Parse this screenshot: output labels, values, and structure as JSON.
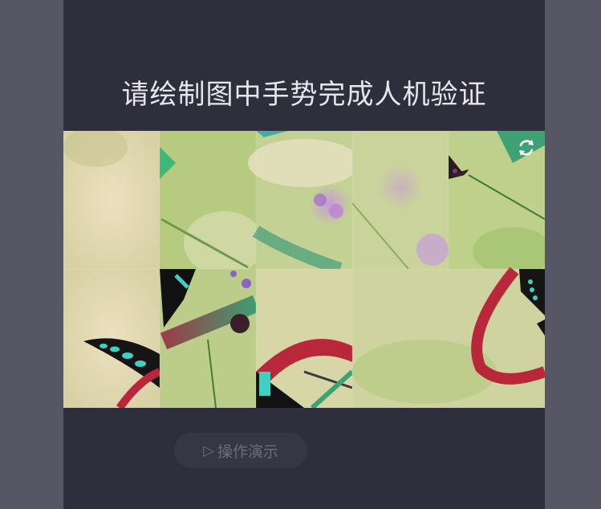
{
  "captcha": {
    "title": "请绘制图中手势完成人机验证",
    "demo_button_label": "操作演示",
    "demo_button_icon": "▷",
    "refresh_icon": "refresh-icon"
  },
  "colors": {
    "page_bg": "#575665",
    "panel_bg": "#2f2e3c",
    "title": "#e6e6ec",
    "gesture_red": "#b8273a",
    "gesture_green": "#3ea372",
    "refresh_green": "#43b37e"
  }
}
